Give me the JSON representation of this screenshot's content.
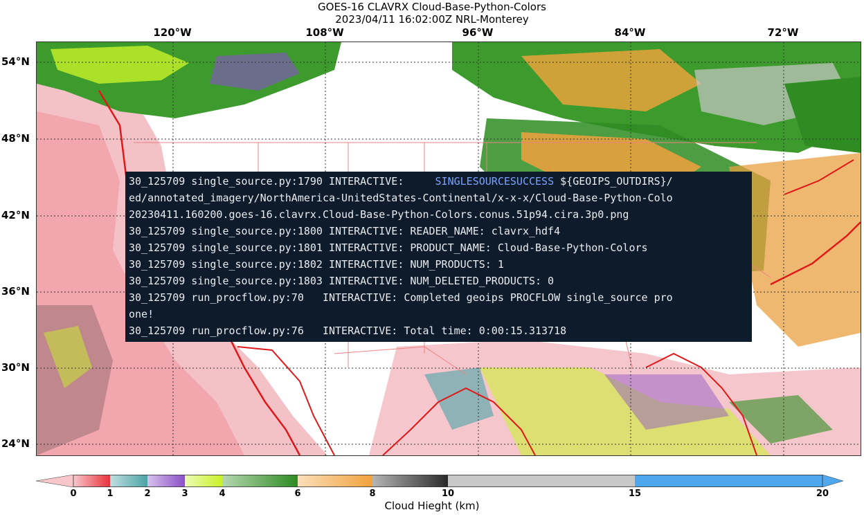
{
  "title": {
    "line1": "GOES-16 CLAVRX Cloud-Base-Python-Colors",
    "line2": "2023/04/11 16:02:00Z NRL-Monterey"
  },
  "map": {
    "longitude_labels": [
      "120°W",
      "108°W",
      "96°W",
      "84°W",
      "72°W"
    ],
    "latitude_labels": [
      "54°N",
      "48°N",
      "42°N",
      "36°N",
      "30°N",
      "24°N"
    ]
  },
  "terminal": {
    "lines": [
      {
        "pre": "30_125709 single_source.py:1790 INTERACTIVE:     ",
        "hl": "SINGLESOURCESUCCESS",
        "post": " ${GEOIPS_OUTDIRS}/"
      },
      {
        "pre": "ed/annotated_imagery/NorthAmerica-UnitedStates-Continental/x-x-x/Cloud-Base-Python-Colo",
        "hl": "",
        "post": ""
      },
      {
        "pre": "20230411.160200.goes-16.clavrx.Cloud-Base-Python-Colors.conus.51p94.cira.3p0.png",
        "hl": "",
        "post": ""
      },
      {
        "pre": "30_125709 single_source.py:1800 INTERACTIVE: READER_NAME: clavrx_hdf4",
        "hl": "",
        "post": ""
      },
      {
        "pre": "30_125709 single_source.py:1801 INTERACTIVE: PRODUCT_NAME: Cloud-Base-Python-Colors",
        "hl": "",
        "post": ""
      },
      {
        "pre": "30_125709 single_source.py:1802 INTERACTIVE: NUM_PRODUCTS: 1",
        "hl": "",
        "post": ""
      },
      {
        "pre": "30_125709 single_source.py:1803 INTERACTIVE: NUM_DELETED_PRODUCTS: 0",
        "hl": "",
        "post": ""
      },
      {
        "pre": "30_125709 run_procflow.py:70   INTERACTIVE: Completed geoips PROCFLOW single_source pro",
        "hl": "",
        "post": ""
      },
      {
        "pre": "one!",
        "hl": "",
        "post": ""
      },
      {
        "pre": "30_125709 run_procflow.py:76   INTERACTIVE: Total time: 0:00:15.313718",
        "hl": "",
        "post": ""
      }
    ]
  },
  "colorbar": {
    "label": "Cloud Hieght (km)",
    "ticks": [
      "0",
      "1",
      "2",
      "3",
      "4",
      "6",
      "8",
      "10",
      "15",
      "20"
    ],
    "segments": [
      {
        "from": 0,
        "to": 1,
        "color": "#e8313a"
      },
      {
        "from": 1,
        "to": 2,
        "color": "#4aa3a6"
      },
      {
        "from": 2,
        "to": 3,
        "color": "#8a50c8"
      },
      {
        "from": 3,
        "to": 4,
        "color": "#c8f228"
      },
      {
        "from": 4,
        "to": 6,
        "color": "#2e8c22"
      },
      {
        "from": 6,
        "to": 8,
        "color": "#f2a23c"
      },
      {
        "from": 8,
        "to": 10,
        "color": "#2a2a2a"
      },
      {
        "from": 10,
        "to": 15,
        "color": "#c8c8c8"
      },
      {
        "from": 15,
        "to": 20,
        "color": "#4fa8ee"
      }
    ],
    "min_color": "#f7c7cb",
    "max_color": "#4fa8ee"
  }
}
